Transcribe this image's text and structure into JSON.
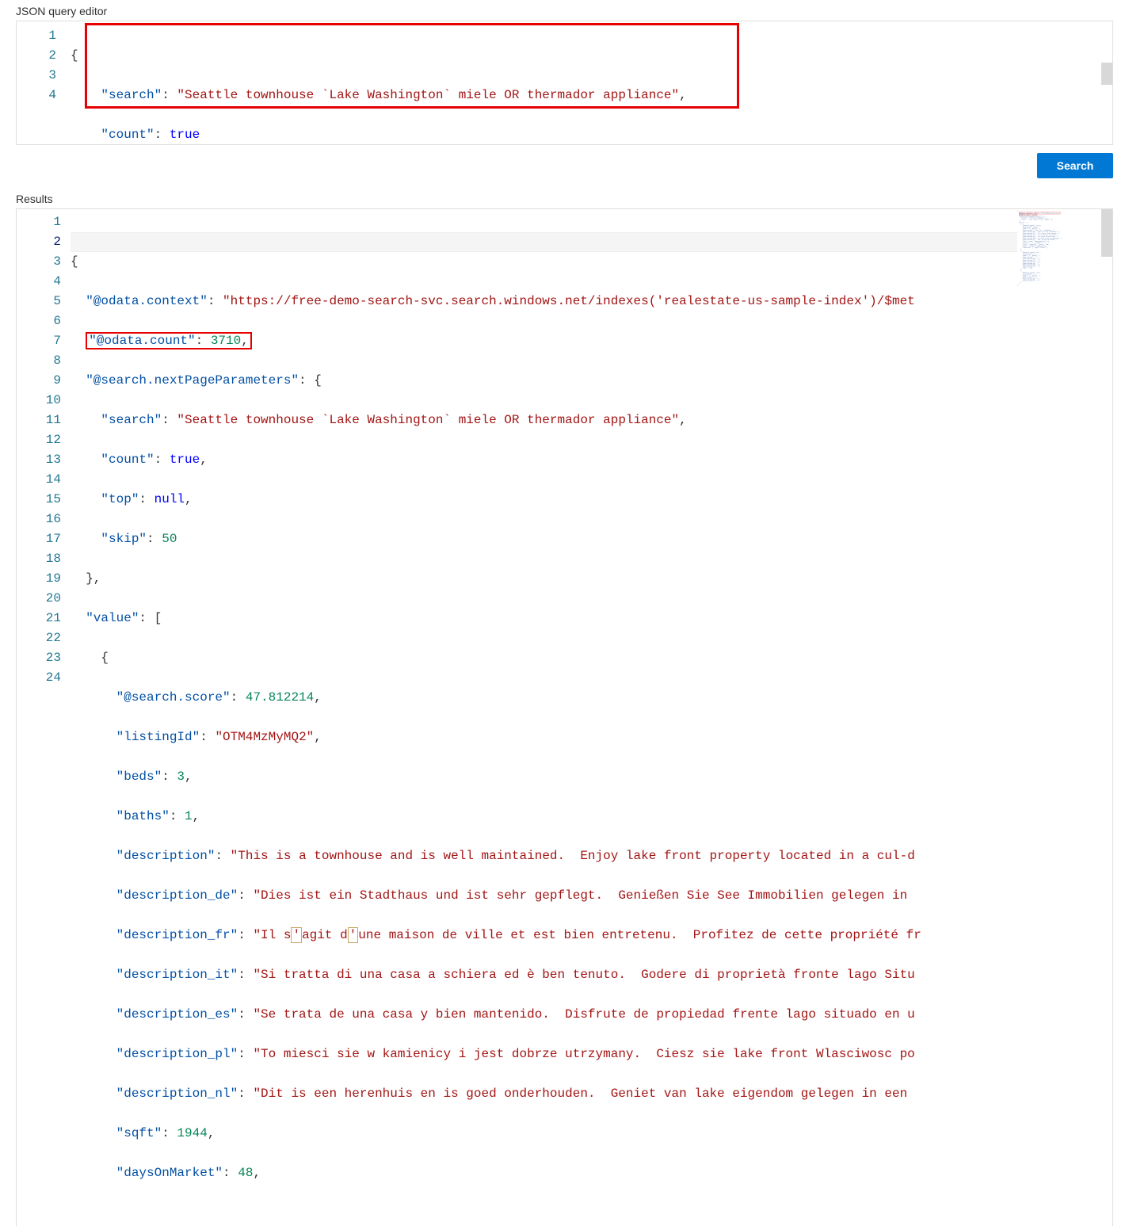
{
  "labels": {
    "editor_title": "JSON query editor",
    "results_title": "Results",
    "search_button": "Search"
  },
  "editor": {
    "line_numbers": [
      "1",
      "2",
      "3",
      "4"
    ],
    "content": {
      "search_value": "Seattle townhouse `Lake Washington` miele OR thermador appliance",
      "count_value": "true"
    }
  },
  "results": {
    "line_numbers": [
      "1",
      "2",
      "3",
      "4",
      "5",
      "6",
      "7",
      "8",
      "9",
      "10",
      "11",
      "12",
      "13",
      "14",
      "15",
      "16",
      "17",
      "18",
      "19",
      "20",
      "21",
      "22",
      "23",
      "24"
    ],
    "odata_context": "https://free-demo-search-svc.search.windows.net/indexes('realestate-us-sample-index')/$met",
    "odata_count": "3710",
    "next_page": {
      "search": "Seattle townhouse `Lake Washington` miele OR thermador appliance",
      "count": "true",
      "top": "null",
      "skip": "50"
    },
    "first_value": {
      "search_score": "47.812214",
      "listingId": "OTM4MzMyMQ2",
      "beds": "3",
      "baths": "1",
      "description": "This is a townhouse and is well maintained.  Enjoy lake front property located in a cul-d",
      "description_de": "Dies ist ein Stadthaus und ist sehr gepflegt.  Genießen Sie See Immobilien gelegen in ",
      "description_fr_pre": "Il s",
      "description_fr_mid": "agit d",
      "description_fr_post": "une maison de ville et est bien entretenu.  Profitez de cette propriété fr",
      "description_it": "Si tratta di una casa a schiera ed è ben tenuto.  Godere di proprietà fronte lago Situ",
      "description_es": "Se trata de una casa y bien mantenido.  Disfrute de propiedad frente lago situado en u",
      "description_pl": "To miesci sie w kamienicy i jest dobrze utrzymany.  Ciesz sie lake front Wlasciwosc po",
      "description_nl": "Dit is een herenhuis en is goed onderhouden.  Geniet van lake eigendom gelegen in een ",
      "sqft": "1944",
      "daysOnMarket": "48"
    }
  }
}
